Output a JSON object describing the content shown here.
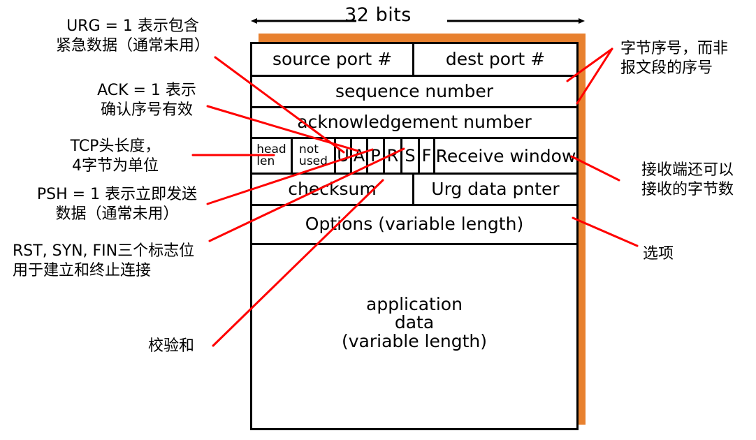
{
  "header": {
    "width_label": "32 bits"
  },
  "colors": {
    "shadow": "#E8812F",
    "leader": "#FF0000",
    "border": "#000000",
    "text": "#000000"
  },
  "tcp_header": {
    "rows": [
      {
        "id": "ports",
        "cells": [
          {
            "label": "source port #"
          },
          {
            "label": "dest port #"
          }
        ]
      },
      {
        "id": "sequence",
        "cells": [
          {
            "label": "sequence number"
          }
        ]
      },
      {
        "id": "acknowledgement",
        "cells": [
          {
            "label": "acknowledgement number"
          }
        ]
      },
      {
        "id": "flags",
        "cells": [
          {
            "label": "head\nlen"
          },
          {
            "label": "not\nused"
          },
          {
            "label": "U"
          },
          {
            "label": "A"
          },
          {
            "label": "P"
          },
          {
            "label": "R"
          },
          {
            "label": "S"
          },
          {
            "label": "F"
          },
          {
            "label": "Receive window"
          }
        ]
      },
      {
        "id": "checksum",
        "cells": [
          {
            "label": "checksum"
          },
          {
            "label": "Urg data pnter"
          }
        ]
      },
      {
        "id": "options",
        "cells": [
          {
            "label": "Options (variable length)"
          }
        ]
      },
      {
        "id": "payload",
        "cells": [
          {
            "label": "application\ndata\n(variable length)"
          }
        ]
      }
    ]
  },
  "annotations": {
    "left": [
      {
        "id": "urg",
        "text": "URG = 1 表示包含\n紧急数据（通常未用）"
      },
      {
        "id": "ack",
        "text": "ACK = 1 表示\n确认序号有效"
      },
      {
        "id": "headlen",
        "text": "TCP头长度，\n4字节为单位"
      },
      {
        "id": "psh",
        "text": "PSH = 1 表示立即发送\n数据（通常未用）"
      },
      {
        "id": "rstsynfin",
        "text": "RST, SYN, FIN三个标志位\n用于建立和终止连接"
      },
      {
        "id": "checksum",
        "text": "校验和"
      }
    ],
    "right": [
      {
        "id": "seqnum",
        "text": "字节序号，而非\n报文段的序号"
      },
      {
        "id": "recvwin",
        "text": "接收端还可以\n接收的字节数"
      },
      {
        "id": "options",
        "text": "选项"
      }
    ]
  }
}
